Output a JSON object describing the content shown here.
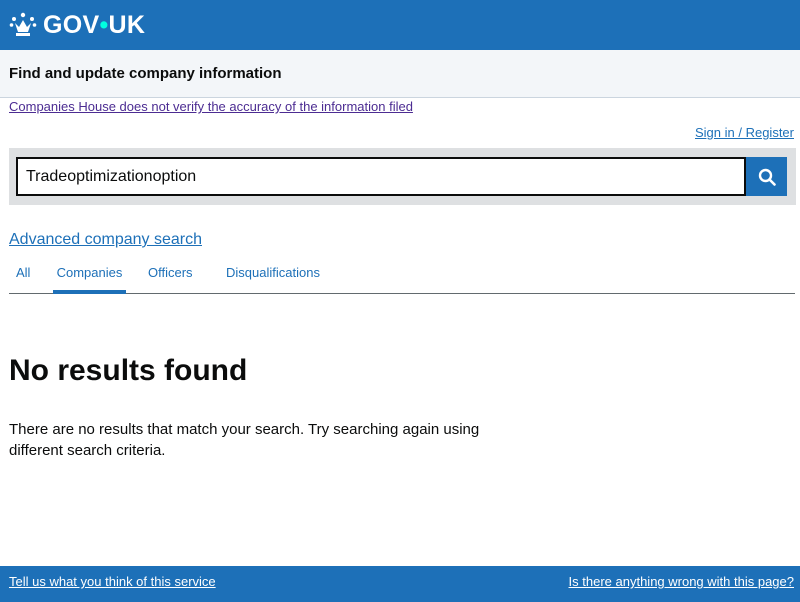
{
  "header": {
    "logo_prefix": "GOV",
    "logo_dot": "•",
    "logo_suffix": "UK",
    "crown_icon": "crown-icon",
    "background_color": "#1d70b8"
  },
  "service": {
    "name": "Find and update company information"
  },
  "disclaimer": {
    "text": "Companies House does not verify the accuracy of the information filed"
  },
  "account": {
    "signin_label": "Sign in / Register"
  },
  "search": {
    "value": "Tradeoptimizationoption",
    "button_icon": "search-icon"
  },
  "advanced_search": {
    "label": "Advanced company search"
  },
  "tabs": [
    {
      "label": "All",
      "active": false
    },
    {
      "label": "Companies",
      "active": true
    },
    {
      "label": "Officers",
      "active": false
    },
    {
      "label": "Disqualifications",
      "active": false
    }
  ],
  "results": {
    "title": "No results found",
    "message": "There are no results that match your search. Try searching again using different search criteria."
  },
  "footer": {
    "feedback_label": "Tell us what you think of this service",
    "report_label": "Is there anything wrong with this page?"
  }
}
